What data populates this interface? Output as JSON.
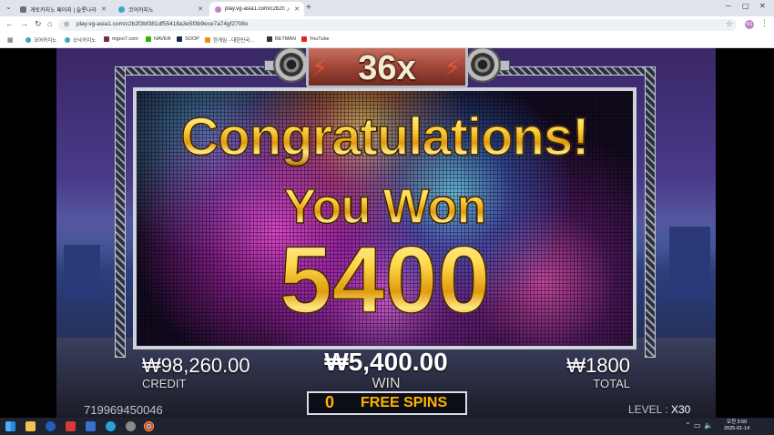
{
  "browser": {
    "tabs": [
      {
        "title": "게토카지노 페이지 | 슬롯나라",
        "active": false
      },
      {
        "title": "코어카지노",
        "active": false
      },
      {
        "title": "play.vg-asia1.com/c2b2f3bf",
        "active": true
      }
    ],
    "url": "play.vg-asia1.com/c2b2f3bf381df55418a3e5f3b9ece7a74gf2708o",
    "profile_initials": "KS",
    "bookmarks": [
      "코어카지노",
      "소낙카지노",
      "mgoo7.com",
      "NAVER",
      "SOOP",
      "한게임 - 대한민국...",
      "BETMAN",
      "YouTube"
    ],
    "colors": {
      "tabstrip": "#dfe3eb",
      "accent": "#c97fc9"
    }
  },
  "game": {
    "multiplier": "36x",
    "headline": "Congratulations!",
    "subheadline": "You Won",
    "win_amount": "5400",
    "credit": {
      "value": "₩98,260.00",
      "label": "CREDIT"
    },
    "win": {
      "value": "₩5,400.00",
      "label": "WIN"
    },
    "total": {
      "value": "₩1800",
      "label": "TOTAL"
    },
    "free_spins": {
      "count": "0",
      "label": "FREE SPINS"
    },
    "transaction_id": "719969450046",
    "level": {
      "label": "LEVEL :",
      "value": "X30"
    },
    "colors": {
      "gold": "#ffd84a",
      "free_spins": "#ffb400",
      "multiplier_panel": "#a04638"
    }
  },
  "taskbar": {
    "time": "오전 3:50",
    "date": "2025-01-14"
  }
}
